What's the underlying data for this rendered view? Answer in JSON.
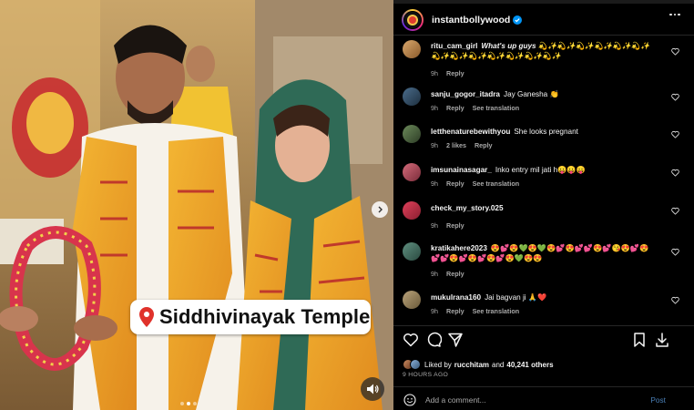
{
  "post": {
    "caption": "Siddhivinayak Temple",
    "carousel": {
      "slides": 3,
      "active_index": 1
    }
  },
  "header": {
    "username": "instantbollywood",
    "verified": true
  },
  "comments": [
    {
      "user": "ritu_cam_girl",
      "text": "What's up guys 💫✨💫✨💫✨💫✨💫✨💫✨💫✨💫✨💫✨💫✨💫✨💫✨💫✨",
      "time": "9h",
      "likes": "",
      "translate": "",
      "reply": "Reply"
    },
    {
      "user": "sanju_gogor_itadra",
      "text": "Jay Ganesha 👏",
      "time": "9h",
      "likes": "",
      "translate": "See translation",
      "reply": "Reply"
    },
    {
      "user": "letthenaturebewithyou",
      "text": "She looks pregnant",
      "time": "9h",
      "likes": "2 likes",
      "translate": "",
      "reply": "Reply"
    },
    {
      "user": "imsunainasagar_",
      "text": "Inko entry mil jati h😛😛😛",
      "time": "9h",
      "likes": "",
      "translate": "See translation",
      "reply": "Reply"
    },
    {
      "user": "check_my_story.025",
      "text": "",
      "time": "9h",
      "likes": "",
      "translate": "",
      "reply": "Reply"
    },
    {
      "user": "kratikahere2023",
      "text": "😍💕😍💚😍💚😍💕😍💕💕😍💕😘😍💕😍💕💕😍💕😍💕😍💕😍💚😍😍",
      "time": "9h",
      "likes": "",
      "translate": "",
      "reply": "Reply"
    },
    {
      "user": "mukulrana160",
      "text": "Jai bagvan ji 🙏❤️",
      "time": "9h",
      "likes": "",
      "translate": "See translation",
      "reply": "Reply"
    }
  ],
  "likes": {
    "prefix": "Liked by",
    "user": "rucchitam",
    "joiner": "and",
    "others": "40,241 others"
  },
  "timestamp": "9 HOURS AGO",
  "composer": {
    "placeholder": "Add a comment...",
    "post_label": "Post"
  },
  "icons": {
    "like": "heart-icon",
    "comment": "comment-icon",
    "share": "share-icon",
    "save": "bookmark-icon",
    "download": "download-icon",
    "more": "more-icon",
    "emoji": "emoji-icon",
    "sound": "speaker-icon",
    "location": "pin-icon"
  },
  "colors": {
    "background": "#000000",
    "text": "#f5f5f5",
    "muted": "#a8a8a8",
    "link": "#4a7fb6",
    "verified": "#0095f6",
    "heart": "#ed4956"
  }
}
